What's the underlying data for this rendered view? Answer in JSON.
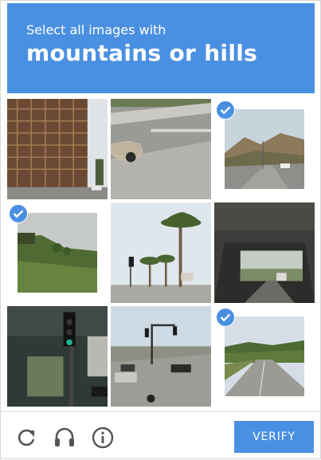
{
  "header": {
    "instruction_sub": "Select all images with",
    "instruction_main": "mountains or hills",
    "background_color": "#4a90e2"
  },
  "grid": {
    "tiles": [
      {
        "description": "building-scaffolding",
        "selected": false
      },
      {
        "description": "car-street",
        "selected": false
      },
      {
        "description": "road-hills",
        "selected": true
      },
      {
        "description": "green-hillside",
        "selected": true
      },
      {
        "description": "palm-trees-traffic-light",
        "selected": false
      },
      {
        "description": "overpass-tunnel",
        "selected": false
      },
      {
        "description": "traffic-light-pole",
        "selected": false
      },
      {
        "description": "intersection-traffic",
        "selected": false
      },
      {
        "description": "highway-hills",
        "selected": true
      }
    ]
  },
  "footer": {
    "icons": [
      "reload-icon",
      "audio-headphones-icon",
      "info-icon"
    ],
    "verify_label": "VERIFY"
  }
}
